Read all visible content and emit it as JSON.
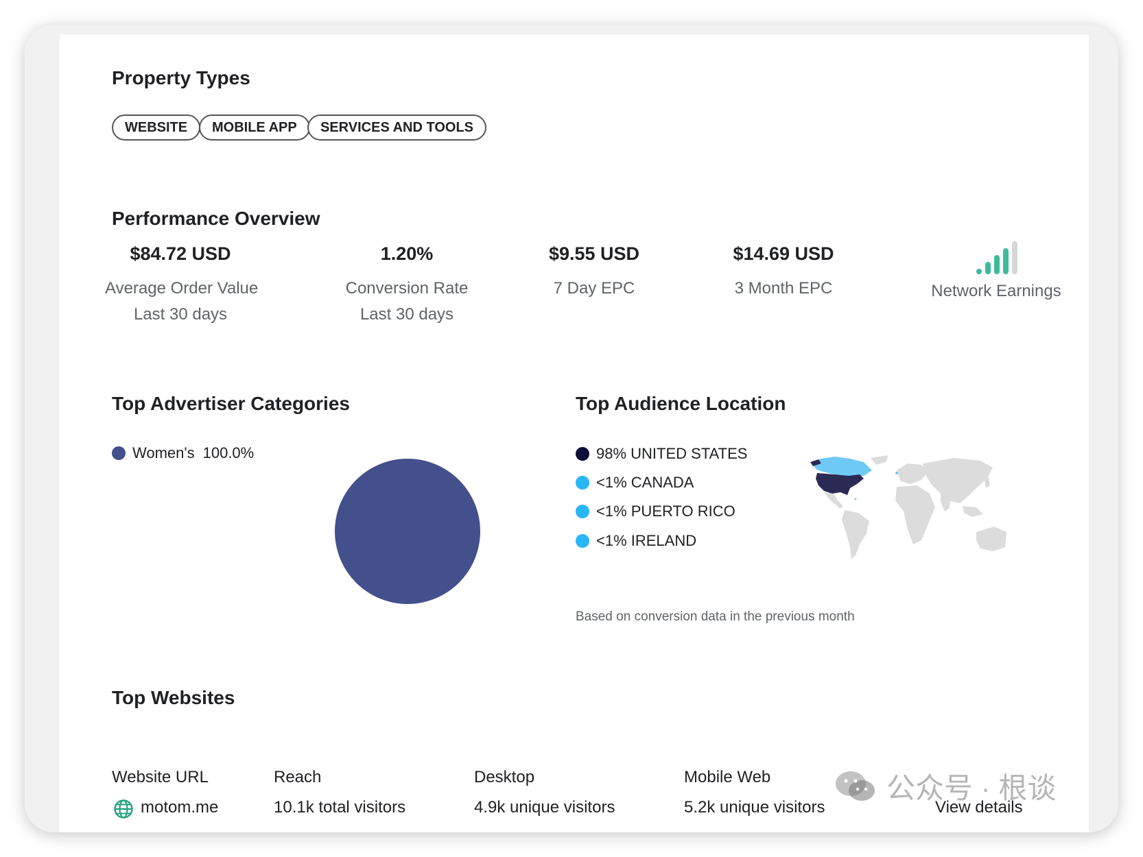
{
  "property_types": {
    "title": "Property Types",
    "chips": [
      "WEBSITE",
      "MOBILE APP",
      "SERVICES AND TOOLS"
    ]
  },
  "performance": {
    "title": "Performance Overview",
    "stats": [
      {
        "value": "$84.72 USD",
        "label": "Average Order Value",
        "sublabel": "Last 30 days"
      },
      {
        "value": "1.20%",
        "label": "Conversion Rate",
        "sublabel": "Last 30 days"
      },
      {
        "value": "$9.55 USD",
        "label": "7 Day EPC"
      },
      {
        "value": "$14.69 USD",
        "label": "3 Month EPC"
      }
    ],
    "network_earnings": {
      "label": "Network Earnings",
      "level": 4,
      "max_level": 5
    }
  },
  "advertiser_categories": {
    "title": "Top Advertiser Categories",
    "legend": [
      {
        "name": "Women's",
        "value": "100.0%"
      }
    ],
    "colors": {
      "women": "#43508c"
    }
  },
  "audience_location": {
    "title": "Top Audience Location",
    "items": [
      {
        "label": "98% UNITED STATES",
        "color": "#0d0d3a"
      },
      {
        "label": "<1% CANADA",
        "color": "#29b6f6"
      },
      {
        "label": "<1% PUERTO RICO",
        "color": "#29b6f6"
      },
      {
        "label": "<1% IRELAND",
        "color": "#29b6f6"
      }
    ],
    "note": "Based on conversion data in the previous month"
  },
  "top_websites": {
    "title": "Top Websites",
    "columns": [
      "Website URL",
      "Reach",
      "Desktop",
      "Mobile Web"
    ],
    "rows": [
      {
        "url": "motom.me",
        "reach": "10.1k total visitors",
        "desktop": "4.9k unique visitors",
        "mobile": "5.2k unique visitors",
        "action": "View details"
      }
    ]
  },
  "watermark": {
    "text": "公众号 · 根谈"
  },
  "chart_data": {
    "type": "pie",
    "categories": [
      "Women's"
    ],
    "values": [
      100.0
    ],
    "title": ""
  }
}
